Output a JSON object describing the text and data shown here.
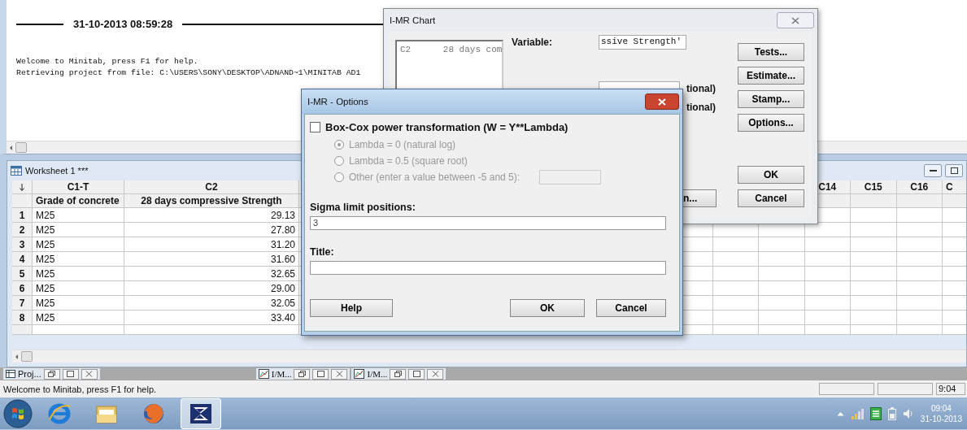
{
  "session": {
    "timestamp": "31-10-2013 08:59:28",
    "lines": [
      "Welcome to Minitab, press F1 for help.",
      "Retrieving project from file: C:\\USERS\\SONY\\DESKTOP\\ADNAND~1\\MINITAB AD1"
    ]
  },
  "worksheet": {
    "title": "Worksheet 1 ***",
    "columns": [
      {
        "header": "C1-T",
        "name": "Grade of concrete"
      },
      {
        "header": "C2",
        "name": "28 days compressive Strength"
      }
    ],
    "right_columns": [
      {
        "header": "C14"
      },
      {
        "header": "C15"
      },
      {
        "header": "C16"
      },
      {
        "header": "C"
      }
    ],
    "rows": [
      {
        "number": "1",
        "cells": [
          "M25",
          "29.13"
        ]
      },
      {
        "number": "2",
        "cells": [
          "M25",
          "27.80"
        ]
      },
      {
        "number": "3",
        "cells": [
          "M25",
          "31.20"
        ]
      },
      {
        "number": "4",
        "cells": [
          "M25",
          "31.60"
        ]
      },
      {
        "number": "5",
        "cells": [
          "M25",
          "32.65"
        ]
      },
      {
        "number": "6",
        "cells": [
          "M25",
          "29.00"
        ]
      },
      {
        "number": "7",
        "cells": [
          "M25",
          "32.05"
        ]
      },
      {
        "number": "8",
        "cells": [
          "M25",
          "33.40"
        ]
      }
    ]
  },
  "chart_dialog": {
    "title": "I-MR Chart",
    "list_item": "C2      28 days com",
    "variable_label": "Variable:",
    "variable_value": "ssive Strength'",
    "optional_labels": [
      "tional)",
      "tional)"
    ],
    "partial_button": "n...",
    "buttons": [
      "Tests...",
      "Estimate...",
      "Stamp...",
      "Options..."
    ],
    "ok": "OK",
    "cancel": "Cancel"
  },
  "options_dialog": {
    "title": "I-MR - Options",
    "boxcox": {
      "label": "Box-Cox power transformation (W = Y**Lambda)",
      "checked": false
    },
    "lambda_options": [
      {
        "kind": "preset",
        "label": "Lambda = 0 (natural log)",
        "selected": true,
        "disabled": true
      },
      {
        "kind": "preset",
        "label": "Lambda = 0.5 (square root)",
        "selected": false,
        "disabled": true
      },
      {
        "kind": "entry",
        "label": "Other (enter a value between -5 and 5):",
        "selected": false,
        "disabled": true
      }
    ],
    "sigma_label": "Sigma limit positions:",
    "sigma_value": "3",
    "title_label": "Title:",
    "help": "Help",
    "ok": "OK",
    "cancel": "Cancel"
  },
  "mdi_bar": {
    "items": [
      {
        "kind": "project",
        "label": "Proj..."
      },
      {
        "kind": "graph",
        "label": "I/M..."
      },
      {
        "kind": "graph",
        "label": "I/M..."
      }
    ]
  },
  "status_bar": {
    "message": "Welcome to Minitab, press F1 for help.",
    "time": "9:04"
  },
  "taskbar": {
    "apps": [
      {
        "kind": "browser-e",
        "selected": false
      },
      {
        "kind": "folder",
        "selected": false
      },
      {
        "kind": "fox",
        "selected": false
      },
      {
        "kind": "minitab",
        "selected": true
      }
    ],
    "time": "09:04",
    "date": "31-10-2013"
  }
}
